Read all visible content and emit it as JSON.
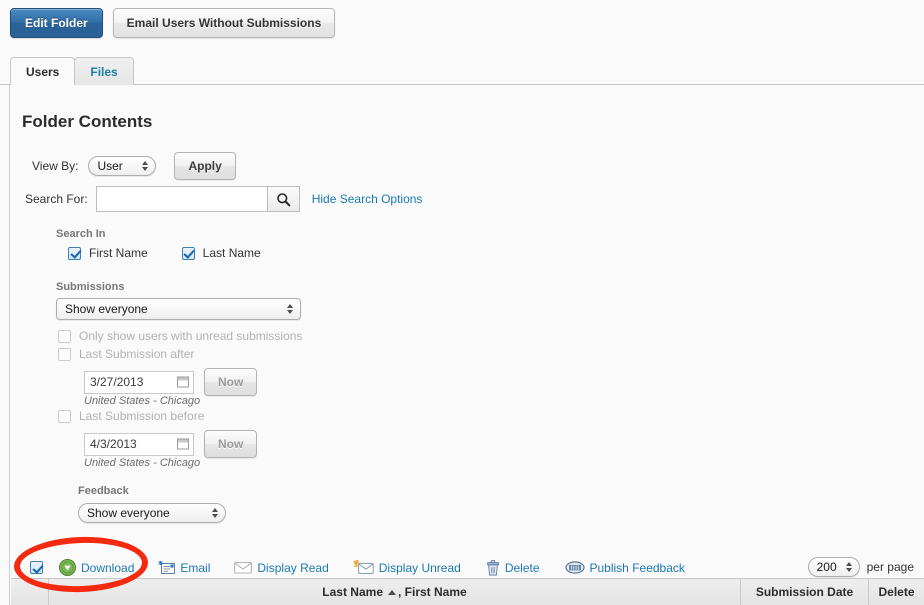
{
  "topbar": {
    "edit_folder_label": "Edit Folder",
    "email_users_label": "Email Users Without Submissions"
  },
  "tabs": [
    {
      "label": "Users",
      "active": true
    },
    {
      "label": "Files",
      "active": false
    }
  ],
  "page_title": "Folder Contents",
  "view_by": {
    "label": "View By:",
    "selected": "User",
    "apply_label": "Apply"
  },
  "search": {
    "label": "Search For:",
    "value": "",
    "placeholder": "",
    "icon": "search-icon",
    "toggle_options_label": "Hide Search Options"
  },
  "search_in": {
    "heading": "Search In",
    "options": [
      {
        "label": "First Name",
        "checked": true
      },
      {
        "label": "Last Name",
        "checked": true
      }
    ]
  },
  "submissions": {
    "heading": "Submissions",
    "selected": "Show everyone",
    "unread_only": {
      "label": "Only show users with unread submissions",
      "checked": false,
      "disabled": true
    },
    "after": {
      "label": "Last Submission after",
      "checked": false,
      "disabled": true,
      "date": "3/27/2013",
      "now_label": "Now",
      "timezone": "United States - Chicago"
    },
    "before": {
      "label": "Last Submission before",
      "checked": false,
      "disabled": true,
      "date": "4/3/2013",
      "now_label": "Now",
      "timezone": "United States - Chicago"
    }
  },
  "feedback": {
    "heading": "Feedback",
    "selected": "Show everyone"
  },
  "toolbar": {
    "select_all_checked": true,
    "actions": [
      {
        "label": "Download",
        "icon": "download-circle-icon"
      },
      {
        "label": "Email",
        "icon": "email-new-icon"
      },
      {
        "label": "Display Read",
        "icon": "envelope-open-icon"
      },
      {
        "label": "Display Unread",
        "icon": "envelope-unread-icon"
      },
      {
        "label": "Delete",
        "icon": "trash-icon"
      },
      {
        "label": "Publish Feedback",
        "icon": "publish-feedback-icon"
      }
    ],
    "per_page": {
      "value": "200",
      "suffix": "per page"
    }
  },
  "table": {
    "columns": [
      {
        "label": ""
      },
      {
        "label": "Last Name , First Name",
        "sort": "asc",
        "sort_on": "Last Name",
        "rest": ", First Name"
      },
      {
        "label": "Submission Date"
      },
      {
        "label": "Delete"
      }
    ]
  },
  "annotation": {
    "shape": "oval",
    "color": "#f42a10",
    "targets": "select-all-checkbox and Download action"
  },
  "colors": {
    "primary_button": "#2f6da5",
    "link": "#1b78b3",
    "page_background": "#fafafa",
    "annotation_red": "#f42a10",
    "download_green": "#5f9f3a"
  }
}
